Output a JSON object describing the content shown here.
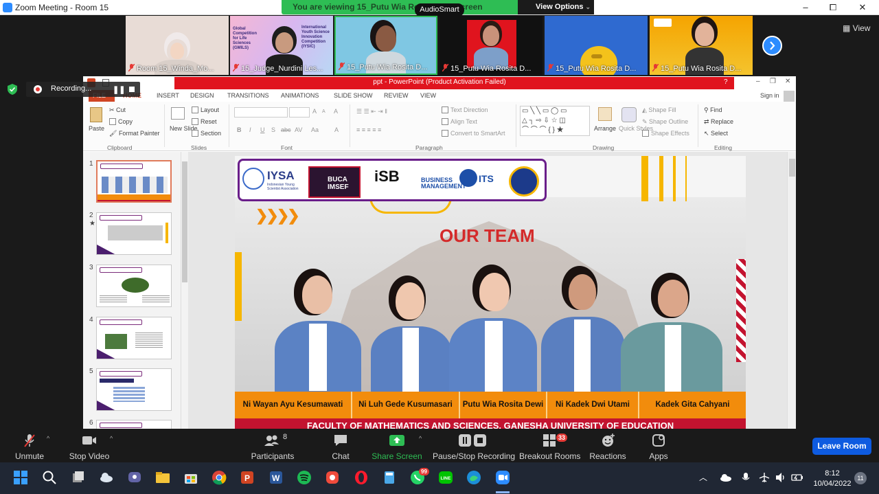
{
  "window": {
    "title": "Zoom Meeting - Room 15",
    "minimize": "–",
    "maximize": "⧠",
    "close": "✕"
  },
  "share_banner": {
    "message": "You are viewing 15_Putu Wia Rosi...er...'s screen",
    "view_options": "View Options",
    "audiosmart": "AudioSmart"
  },
  "gallery": {
    "tiles": [
      {
        "name": "Room 15_Winda_Mo..."
      },
      {
        "name": "15_Judge_Nurdini Les..."
      },
      {
        "name": "15_Putu Wia Rosita D..."
      },
      {
        "name": "15_Putu Wia Rosita D..."
      },
      {
        "name": "15_Putu Wia Rosita D..."
      },
      {
        "name": "15_Putu Wia Rosita D..."
      }
    ],
    "tile2_text_left": "Global Competition for Life Sciences (GMILS)",
    "tile2_text_right": "International Youth Science Innovation Competition (IYSIC)",
    "view_label": "View"
  },
  "recording": {
    "label": "Recording..."
  },
  "powerpoint": {
    "title": "ppt - PowerPoint (Product Activation Failed)",
    "help": "?",
    "signin": "Sign in",
    "tabs": [
      "FILE",
      "HOME",
      "INSERT",
      "DESIGN",
      "TRANSITIONS",
      "ANIMATIONS",
      "SLIDE SHOW",
      "REVIEW",
      "VIEW"
    ],
    "clipboard": {
      "paste": "Paste",
      "cut": "Cut",
      "copy": "Copy",
      "format_painter": "Format Painter",
      "group": "Clipboard"
    },
    "slides": {
      "new_slide": "New Slide",
      "layout": "Layout",
      "reset": "Reset",
      "section": "Section",
      "group": "Slides"
    },
    "font": {
      "bold": "B",
      "italic": "I",
      "underline": "U",
      "strike": "S",
      "shadow": "abc",
      "spacing": "AV",
      "case": "Aa",
      "color": "A",
      "grow": "A",
      "shrink": "A",
      "clear": "A",
      "group": "Font"
    },
    "paragraph": {
      "text_direction": "Text Direction",
      "align_text": "Align Text",
      "convert": "Convert to SmartArt",
      "group": "Paragraph"
    },
    "drawing": {
      "arrange": "Arrange",
      "quick_styles": "Quick Styles",
      "shape_fill": "Shape Fill",
      "shape_outline": "Shape Outline",
      "shape_effects": "Shape Effects",
      "group": "Drawing"
    },
    "editing": {
      "find": "Find",
      "replace": "Replace",
      "select": "Select",
      "group": "Editing"
    },
    "slide_numbers": [
      "1",
      "2",
      "3",
      "4",
      "5",
      "6"
    ],
    "slide": {
      "logos": [
        "IYSA",
        "Indonesian Young Scientist Association",
        "BUCA IMSEF",
        "iSB",
        "BUSINESS MANAGEMENT",
        "ITS"
      ],
      "title": "OUR TEAM",
      "members": [
        "Ni Wayan Ayu Kesumawati",
        "Ni Luh Gede Kusumasari",
        "Putu Wia Rosita Dewi",
        "Ni Kadek Dwi Utami",
        "Kadek Gita Cahyani"
      ],
      "footer": "FACULTY OF MATHEMATICS AND SCIENCES, GANESHA UNIVERSITY OF EDUCATION"
    }
  },
  "toolbar": {
    "unmute": "Unmute",
    "stop_video": "Stop Video",
    "participants": "Participants",
    "participants_count": "8",
    "chat": "Chat",
    "share_screen": "Share Screen",
    "pause_recording": "Pause/Stop Recording",
    "breakout_rooms": "Breakout Rooms",
    "breakout_badge": "33",
    "reactions": "Reactions",
    "apps": "Apps",
    "leave_room": "Leave Room"
  },
  "taskbar": {
    "whatsapp_badge": "99",
    "time": "8:12",
    "date": "10/04/2022",
    "notifications": "11"
  },
  "colors": {
    "zoom_blue": "#2d8cff",
    "share_green": "#2ebd54",
    "ppt_red": "#e0141e",
    "slide_orange": "#f28c0c",
    "slide_title_red": "#d42a2a",
    "leave_blue": "#0e5be0"
  }
}
